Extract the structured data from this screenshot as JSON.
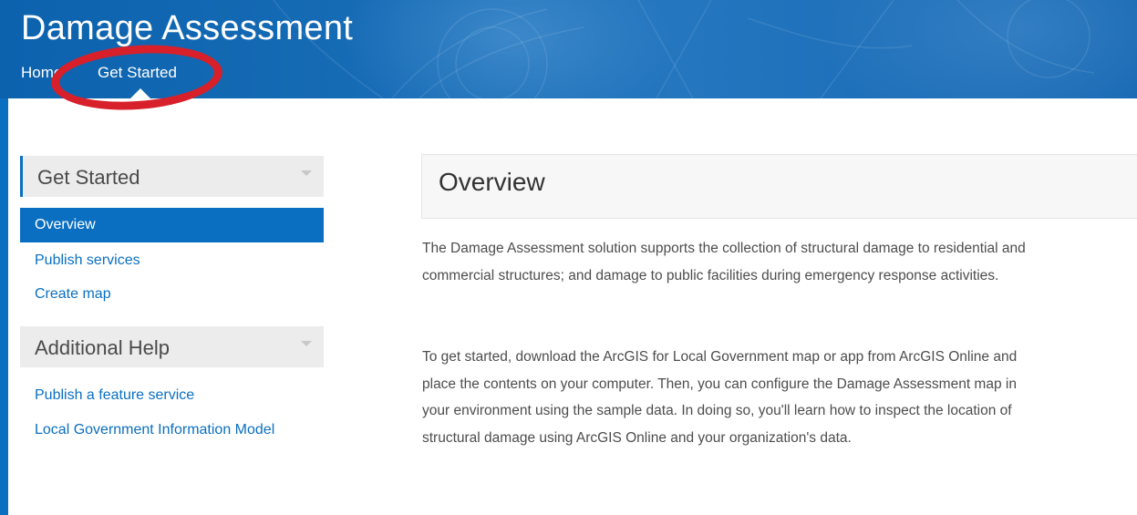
{
  "header": {
    "title": "Damage Assessment",
    "breadcrumb": {
      "home": "Home",
      "current": "Get Started"
    }
  },
  "sidebar": {
    "sections": [
      {
        "title": "Get Started",
        "items": [
          {
            "label": "Overview",
            "active": true
          },
          {
            "label": "Publish services",
            "active": false
          },
          {
            "label": "Create map",
            "active": false
          }
        ]
      },
      {
        "title": "Additional Help",
        "items": [
          {
            "label": "Publish a feature service",
            "active": false
          },
          {
            "label": "Local Government Information Model",
            "active": false
          }
        ]
      }
    ]
  },
  "main": {
    "heading": "Overview",
    "paragraphs": [
      "The Damage Assessment solution supports the collection of structural damage to residential and commercial structures; and damage to public facilities during emergency response activities.",
      "To get started, download the ArcGIS for Local Government map or app from ArcGIS Online and place the contents on your computer. Then, you can configure the Damage Assessment map in your environment using the sample data. In doing so, you'll learn how to inspect the location of structural damage using ArcGIS Online and your organization's data."
    ]
  },
  "colors": {
    "brand_blue": "#0a6fc1",
    "highlight_red": "#d8202a",
    "sidebar_header_bg": "#ececec"
  },
  "icons": [
    "chevron-down-icon",
    "breadcrumb-pointer-icon"
  ]
}
